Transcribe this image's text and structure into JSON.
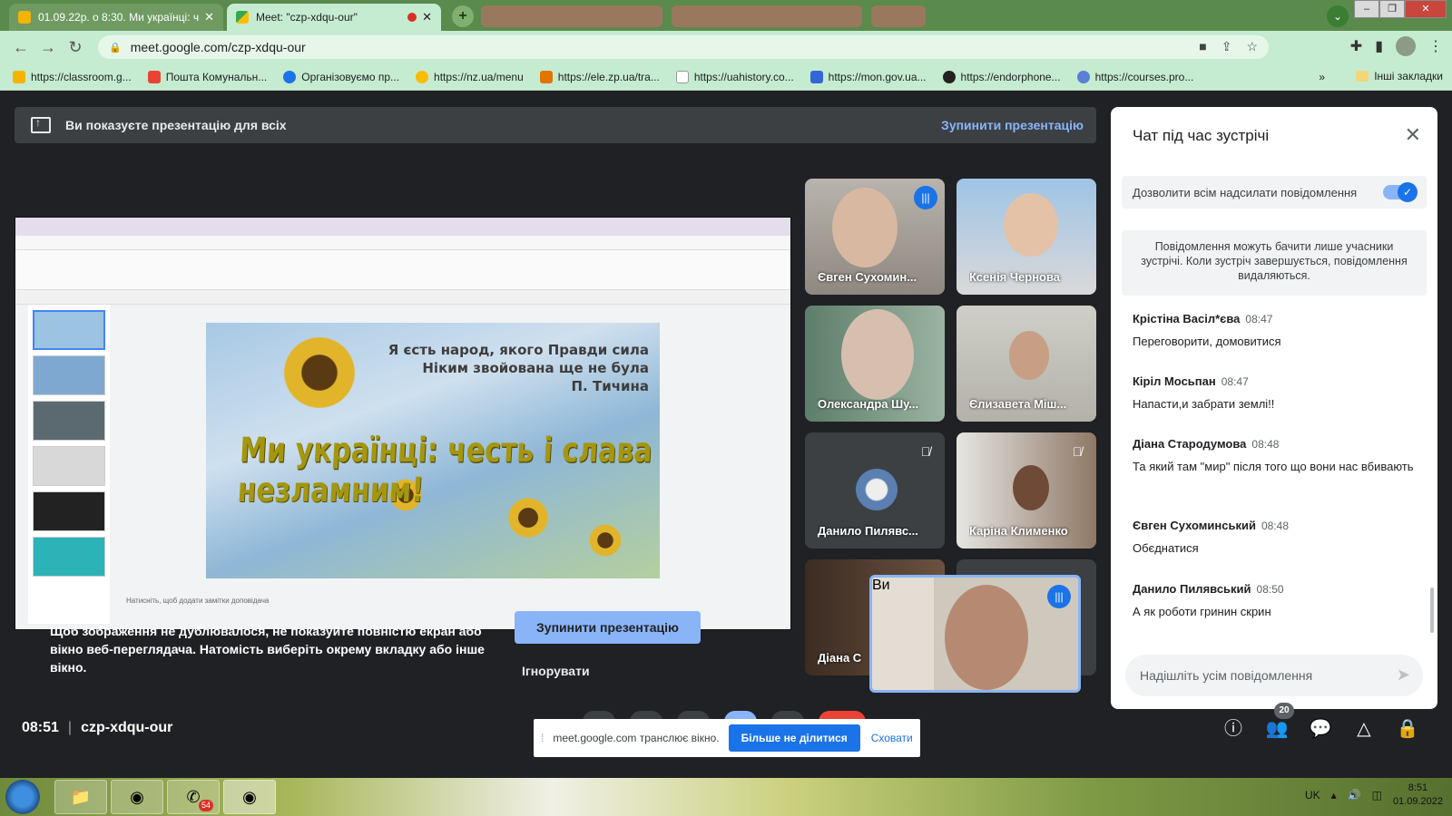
{
  "browser": {
    "tabs": [
      {
        "title": "01.09.22р. о 8:30. Ми українці: ч",
        "active": false
      },
      {
        "title": "Meet: \"czp-xdqu-our\"",
        "active": true
      }
    ],
    "url": "meet.google.com/czp-xdqu-our",
    "bookmarks": [
      "https://classroom.g...",
      "Пошта Комунальн...",
      "Організовуємо пр...",
      "https://nz.ua/menu",
      "https://ele.zp.ua/tra...",
      "https://uahistory.co...",
      "https://mon.gov.ua...",
      "https://endorphone...",
      "https://courses.pro..."
    ],
    "bookmarks_more": "»",
    "other_bookmarks": "Інші закладки"
  },
  "banner": {
    "text": "Ви показуєте презентацію для всіх",
    "stop": "Зупинити презентацію"
  },
  "slide": {
    "quote_line1": "Я єсть народ, якого Правди сила",
    "quote_line2": "Ніким звойована ще не була",
    "quote_author": "П. Тичина",
    "headline": "Ми українці: честь і слава незламним!",
    "notes_hint": "Натисніть, щоб додати замітки доповідача"
  },
  "participants": [
    {
      "name": "Євген Сухомин...",
      "status": "talking"
    },
    {
      "name": "Ксенія Чернова",
      "status": ""
    },
    {
      "name": "Олександра Шу...",
      "status": ""
    },
    {
      "name": "Єлизавета Міш...",
      "status": ""
    },
    {
      "name": "Данило Пилявс...",
      "status": "muted"
    },
    {
      "name": "Каріна Клименко",
      "status": "muted"
    },
    {
      "name": "Діана С",
      "status": ""
    }
  ],
  "self_tile": {
    "name": "Ви",
    "status": "talking"
  },
  "warning": {
    "text": "Щоб зображення не дублювалося, не показуйте повністю екран або вікно веб-переглядача. Натомість виберіть окрему вкладку або інше вікно.",
    "button": "Зупинити презентацію",
    "ignore": "Ігнорувати"
  },
  "chat": {
    "title": "Чат під час зустрічі",
    "allow_label": "Дозволити всім надсилати повідомлення",
    "allow_enabled": true,
    "info": "Повідомлення можуть бачити лише учасники зустрічі. Коли зустріч завершується, повідомлення видаляються.",
    "messages": [
      {
        "author": "Крістіна Васіл*єва",
        "time": "08:47",
        "text": "Переговорити, домовитися"
      },
      {
        "author": "Кіріл Мосьпан",
        "time": "08:47",
        "text": "Напасти,и забрати землі!!"
      },
      {
        "author": "Діана Стародумова",
        "time": "08:48",
        "text": "Та який там \"мир\" після того що вони нас вбивають"
      },
      {
        "author": "Євген Сухоминський",
        "time": "08:48",
        "text": "Обєднатися"
      },
      {
        "author": "Данило Пилявський",
        "time": "08:50",
        "text": "А як роботи гринин скрин"
      }
    ],
    "input_placeholder": "Надішліть усім повідомлення"
  },
  "footer": {
    "time": "08:51",
    "meeting_code": "czp-xdqu-our",
    "people_count": "20"
  },
  "share_bar": {
    "text": "meet.google.com транслює вікно.",
    "stop": "Більше не ділитися",
    "hide": "Сховати"
  },
  "taskbar": {
    "language": "UK",
    "clock_time": "8:51",
    "clock_date": "01.09.2022",
    "viber_badge": "54"
  },
  "colors": {
    "meet_bg": "#202124",
    "accent_blue": "#1a73e8",
    "link_blue": "#8ab4f8",
    "tab_bar": "#5a8a4c",
    "toolbar": "#c5ecd0"
  }
}
